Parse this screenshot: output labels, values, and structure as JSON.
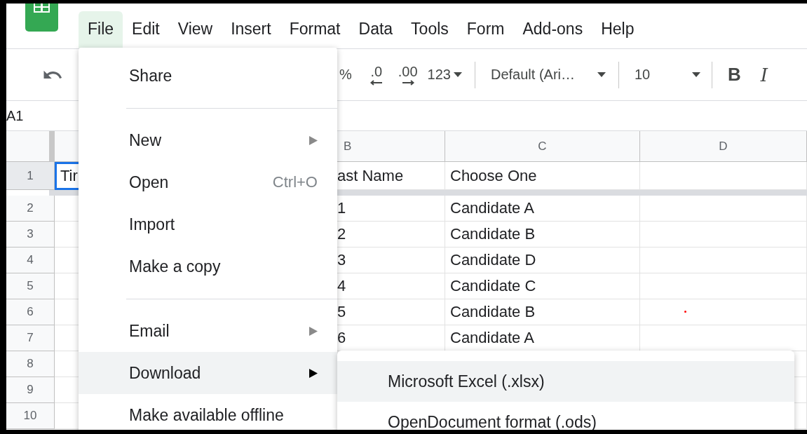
{
  "menubar": {
    "items": [
      {
        "label": "File",
        "selected": true
      },
      {
        "label": "Edit",
        "selected": false
      },
      {
        "label": "View",
        "selected": false
      },
      {
        "label": "Insert",
        "selected": false
      },
      {
        "label": "Format",
        "selected": false
      },
      {
        "label": "Data",
        "selected": false
      },
      {
        "label": "Tools",
        "selected": false
      },
      {
        "label": "Form",
        "selected": false
      },
      {
        "label": "Add-ons",
        "selected": false
      },
      {
        "label": "Help",
        "selected": false
      }
    ]
  },
  "toolbar": {
    "percent": "%",
    "decrease_decimal": ".0",
    "increase_decimal": ".00",
    "number_format": "123",
    "font": "Default (Ari…",
    "font_size": "10",
    "bold": "B",
    "italic": "I"
  },
  "name_box": "A1",
  "grid": {
    "columns": [
      "B",
      "C",
      "D"
    ],
    "rows": [
      {
        "number": "1",
        "selected": true,
        "a": "Tir",
        "b": "ast Name",
        "c": "Choose One"
      },
      {
        "number": "2",
        "selected": false,
        "b": "1",
        "c": "Candidate A"
      },
      {
        "number": "3",
        "selected": false,
        "b": "2",
        "c": "Candidate B"
      },
      {
        "number": "4",
        "selected": false,
        "b": "3",
        "c": "Candidate D"
      },
      {
        "number": "5",
        "selected": false,
        "b": "4",
        "c": "Candidate C"
      },
      {
        "number": "6",
        "selected": false,
        "b": "5",
        "c": "Candidate B",
        "d_mark": true
      },
      {
        "number": "7",
        "selected": false,
        "b": "6",
        "c": "Candidate A"
      },
      {
        "number": "8",
        "selected": false
      },
      {
        "number": "9",
        "selected": false
      },
      {
        "number": "10",
        "selected": false
      }
    ]
  },
  "file_menu": {
    "items": [
      {
        "kind": "item",
        "label": "Share",
        "selected": false
      },
      {
        "kind": "divider"
      },
      {
        "kind": "item",
        "label": "New",
        "submenu": true,
        "selected": false
      },
      {
        "kind": "item",
        "label": "Open",
        "shortcut": "Ctrl+O",
        "selected": false
      },
      {
        "kind": "item",
        "label": "Import",
        "selected": false
      },
      {
        "kind": "item",
        "label": "Make a copy",
        "selected": false
      },
      {
        "kind": "divider"
      },
      {
        "kind": "item",
        "label": "Email",
        "submenu": true,
        "selected": false
      },
      {
        "kind": "item",
        "label": "Download",
        "submenu": true,
        "selected": true
      },
      {
        "kind": "item",
        "label": "Make available offline",
        "selected": false
      }
    ]
  },
  "download_submenu": {
    "items": [
      {
        "label": "Microsoft Excel (.xlsx)",
        "selected": true
      },
      {
        "label": "OpenDocument format (.ods)",
        "selected": false
      }
    ]
  }
}
